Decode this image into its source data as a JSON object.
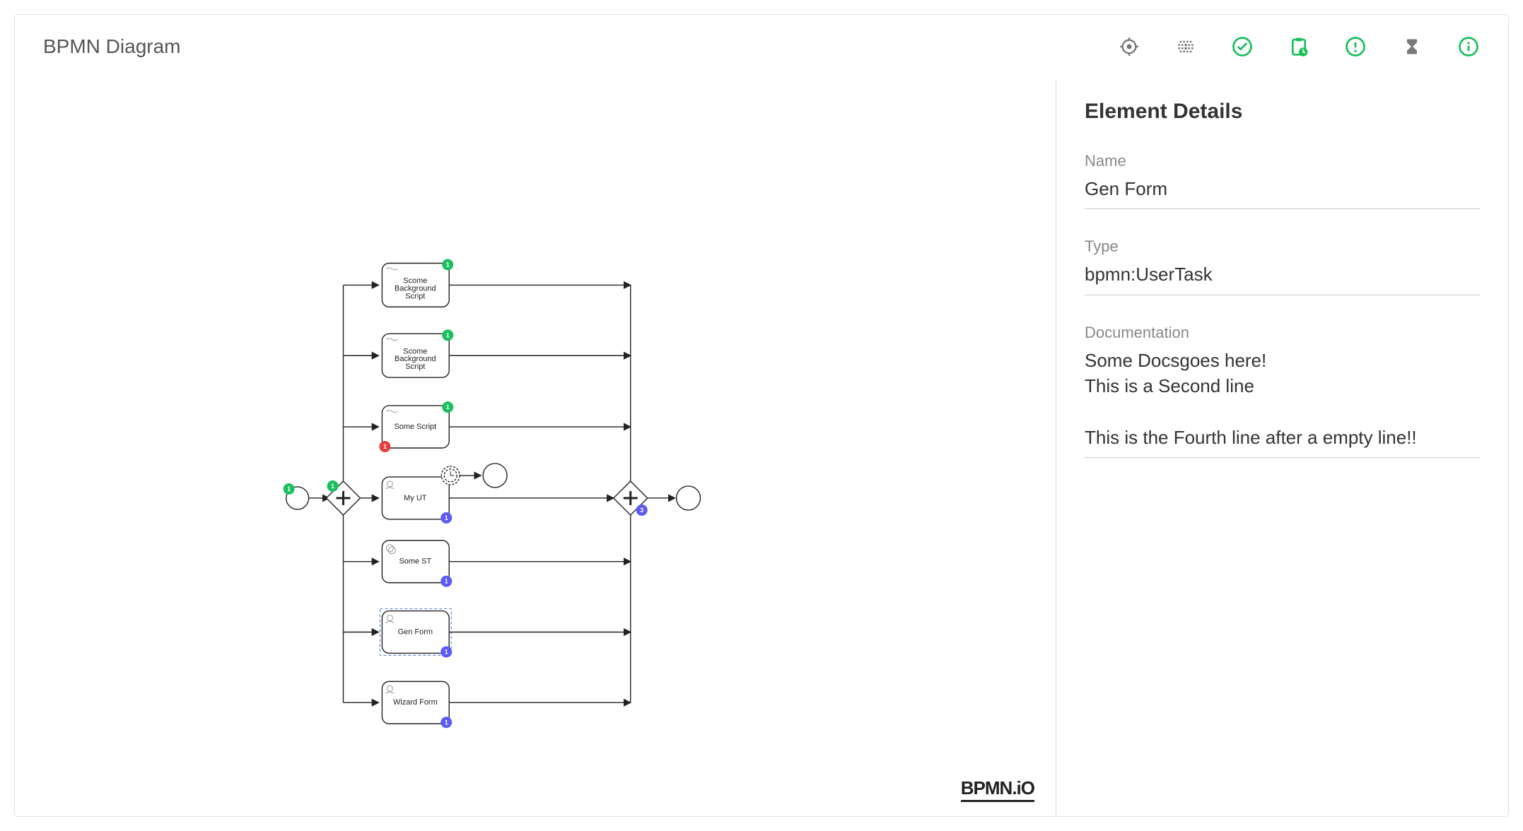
{
  "title": "BPMN Diagram",
  "toolbar": {
    "icons": [
      "target",
      "grid",
      "check",
      "clipboard",
      "alert",
      "hourglass",
      "info"
    ]
  },
  "logo": "BPMN.iO",
  "sidebar": {
    "heading": "Element Details",
    "name_label": "Name",
    "name_value": "Gen Form",
    "type_label": "Type",
    "type_value": "bpmn:UserTask",
    "doc_label": "Documentation",
    "doc_value": "Some Docsgoes here!\nThis is a Second line\n\nThis is the Fourth line after a empty line!!"
  },
  "diagram": {
    "start_event": {
      "label": ""
    },
    "gateway1": {
      "badge": "1",
      "badge_color": "g"
    },
    "gateway2": {
      "badge": "3",
      "badge_color": "b"
    },
    "end_event": {
      "label": ""
    },
    "intermediate_event": {
      "label": ""
    },
    "timer_event": {
      "label": ""
    },
    "tasks": [
      {
        "id": "t1",
        "label": "Scome Background Script",
        "type": "script",
        "badges": [
          {
            "n": "1",
            "c": "g",
            "pos": "tr"
          }
        ]
      },
      {
        "id": "t2",
        "label": "Scome Background Script",
        "type": "script",
        "badges": [
          {
            "n": "1",
            "c": "g",
            "pos": "tr"
          }
        ]
      },
      {
        "id": "t3",
        "label": "Some Script",
        "type": "script",
        "badges": [
          {
            "n": "1",
            "c": "g",
            "pos": "tr"
          },
          {
            "n": "1",
            "c": "r",
            "pos": "bl"
          }
        ]
      },
      {
        "id": "t4",
        "label": "My UT",
        "type": "user",
        "badges": [
          {
            "n": "1",
            "c": "b",
            "pos": "br"
          }
        ]
      },
      {
        "id": "t5",
        "label": "Some ST",
        "type": "service",
        "badges": [
          {
            "n": "1",
            "c": "b",
            "pos": "br"
          }
        ]
      },
      {
        "id": "t6",
        "label": "Gen Form",
        "type": "user",
        "selected": true,
        "badges": [
          {
            "n": "1",
            "c": "b",
            "pos": "br"
          }
        ]
      },
      {
        "id": "t7",
        "label": "Wizard Form",
        "type": "user",
        "badges": [
          {
            "n": "1",
            "c": "b",
            "pos": "br"
          }
        ]
      }
    ]
  }
}
